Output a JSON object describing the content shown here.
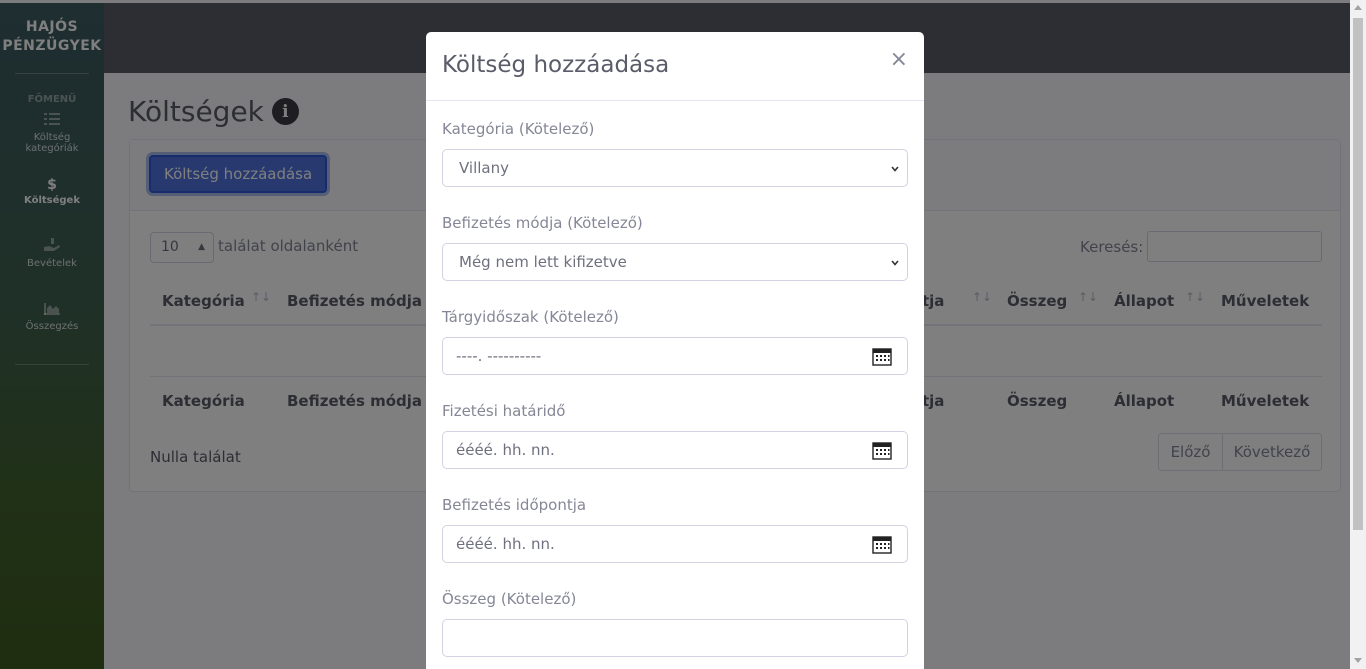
{
  "sidebar": {
    "brand_line1": "HAJÓS",
    "brand_line2": "PÉNZÜGYEK",
    "heading": "FŐMENÜ",
    "items": [
      {
        "label_line1": "Költség",
        "label_line2": "kategóriák",
        "icon": "list-icon"
      },
      {
        "label_line1": "Költségek",
        "label_line2": "",
        "icon": "dollar-icon"
      },
      {
        "label_line1": "Bevételek",
        "label_line2": "",
        "icon": "hand-holding-usd-icon"
      },
      {
        "label_line1": "Összegzés",
        "label_line2": "",
        "icon": "chart-area-icon"
      }
    ]
  },
  "page": {
    "title": "Költségek",
    "add_button": "Költség hozzáadása",
    "length_value": "10",
    "length_label": "találat oldalanként",
    "search_label": "Keresés:",
    "columns": [
      "Kategória",
      "Befizetés módja",
      "tja",
      "Összeg",
      "Állapot",
      "Műveletek"
    ],
    "empty_text": "Nulla találat",
    "prev_label": "Előző",
    "next_label": "Következő"
  },
  "modal": {
    "title": "Költség hozzáadása",
    "close": "×",
    "fields": {
      "category_label": "Kategória (Kötelező)",
      "category_value": "Villany",
      "payment_label": "Befizetés módja (Kötelező)",
      "payment_value": "Még nem lett kifizetve",
      "period_label": "Tárgyidőszak (Kötelező)",
      "period_placeholder": "----. ----------",
      "deadline_label": "Fizetési határidő",
      "deadline_placeholder": "éééé. hh. nn.",
      "paid_label": "Befizetés időpontja",
      "paid_placeholder": "éééé. hh. nn.",
      "amount_label": "Összeg (Kötelező)",
      "amount_value": ""
    }
  }
}
